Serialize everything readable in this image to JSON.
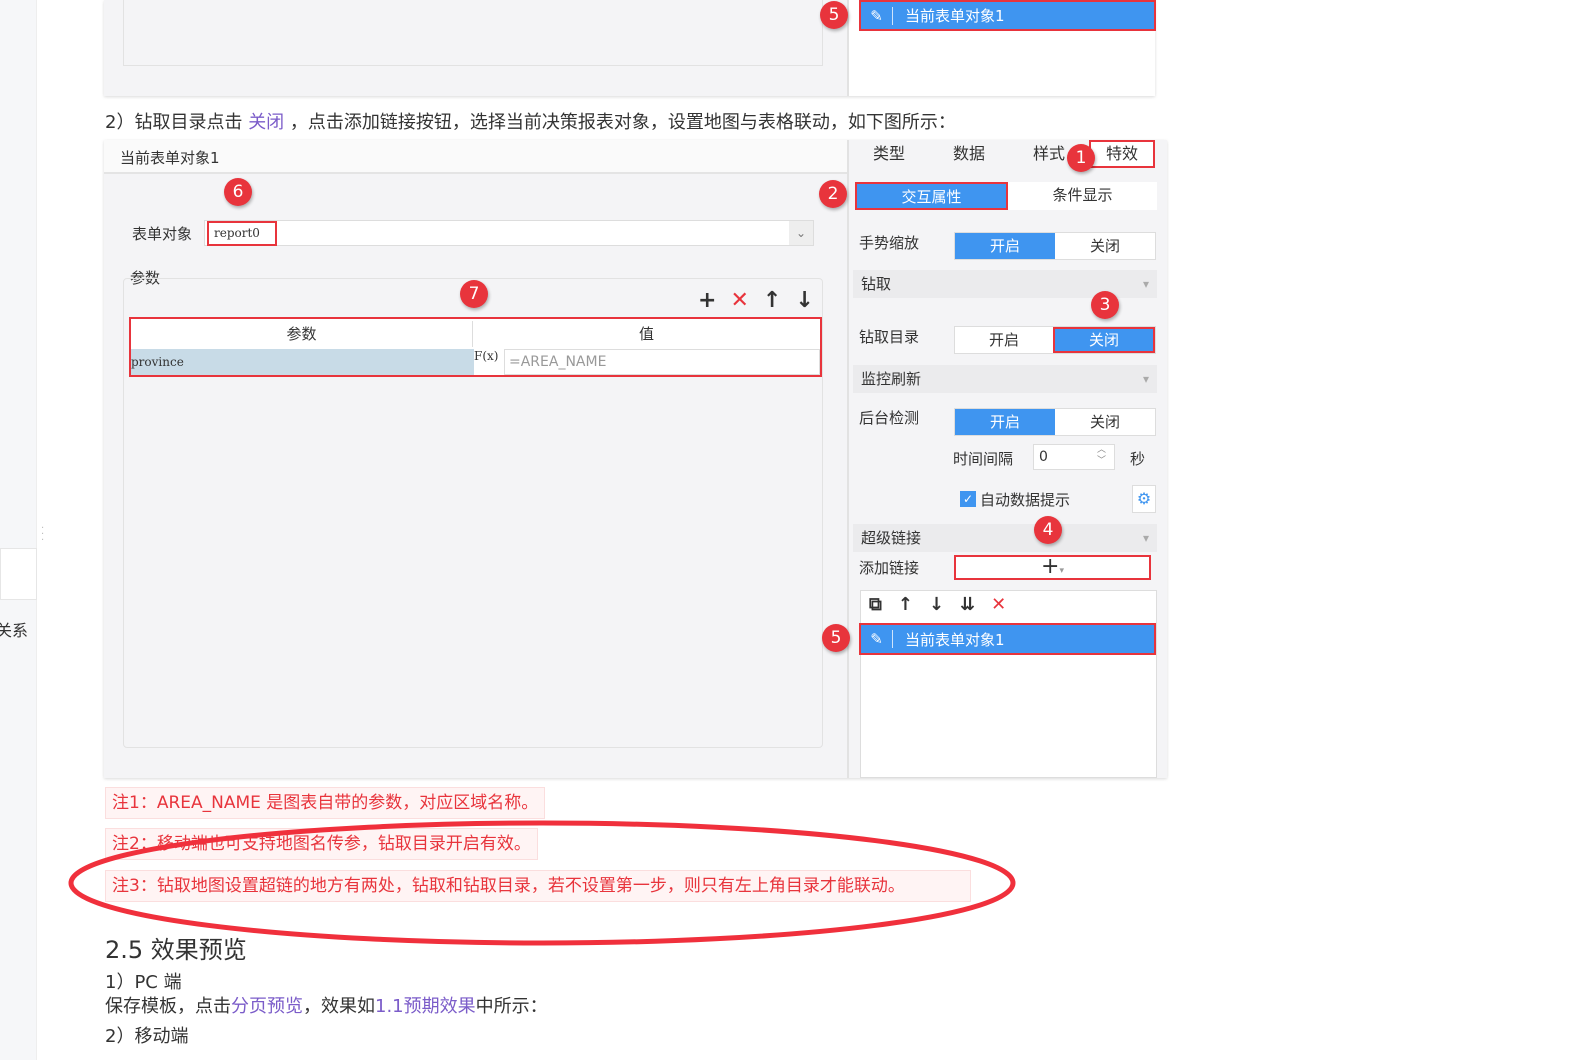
{
  "sidebar": {
    "partial_label": "关系"
  },
  "top_shot": {
    "badge": "5",
    "item_label": "当前表单对象1"
  },
  "step2": {
    "prefix": "2）钻取目录点击 ",
    "link": "关闭",
    "suffix": " ，点击添加链接按钮，选择当前决策报表对象，设置地图与表格联动，如下图所示："
  },
  "shot": {
    "header": "当前表单对象1",
    "form_label": "表单对象",
    "form_value": "report0",
    "params_label": "参数",
    "table": {
      "headers": [
        "参数",
        "值"
      ],
      "rows": [
        {
          "param": "province",
          "fx": "F(x)",
          "value": "=AREA_NAME"
        }
      ]
    },
    "tabs": [
      "类型",
      "数据",
      "样式",
      "特效"
    ],
    "subtabs": [
      "交互属性",
      "条件显示"
    ],
    "gesture": {
      "label": "手势缩放",
      "on": "开启",
      "off": "关闭"
    },
    "drill": {
      "label": "钻取"
    },
    "drill_dir": {
      "label": "钻取目录",
      "on": "开启",
      "off": "关闭"
    },
    "monitor": {
      "label": "监控刷新"
    },
    "backend": {
      "label": "后台检测",
      "on": "开启",
      "off": "关闭"
    },
    "interval": {
      "label": "时间间隔",
      "value": "0",
      "unit": "秒"
    },
    "auto_tip": {
      "label": "自动数据提示",
      "checked": true
    },
    "hyperlink": {
      "label": "超级链接"
    },
    "add_link": {
      "label": "添加链接",
      "button": "+"
    },
    "link_item": "当前表单对象1",
    "badges": [
      "1",
      "2",
      "3",
      "4",
      "5",
      "6",
      "7"
    ]
  },
  "notes": [
    "注1：AREA_NAME 是图表自带的参数，对应区域名称。",
    "注2：移动端也可支持地图名传参，钻取目录开启有效。",
    "注3：钻取地图设置超链的地方有两处，钻取和钻取目录，若不设置第一步，则只有左上角目录才能联动。"
  ],
  "section": {
    "title": "2.5 效果预览",
    "pc": "1）PC 端",
    "pc_text1": "保存模板，点击",
    "pc_link1": "分页预览",
    "pc_text2": "，效果如",
    "pc_link2": "1.1预期效果",
    "pc_text3": "中所示：",
    "mobile": "2）移动端"
  },
  "colors": {
    "accent": "#3f95f0",
    "red": "#e8343c",
    "link": "#7b5cc9"
  }
}
